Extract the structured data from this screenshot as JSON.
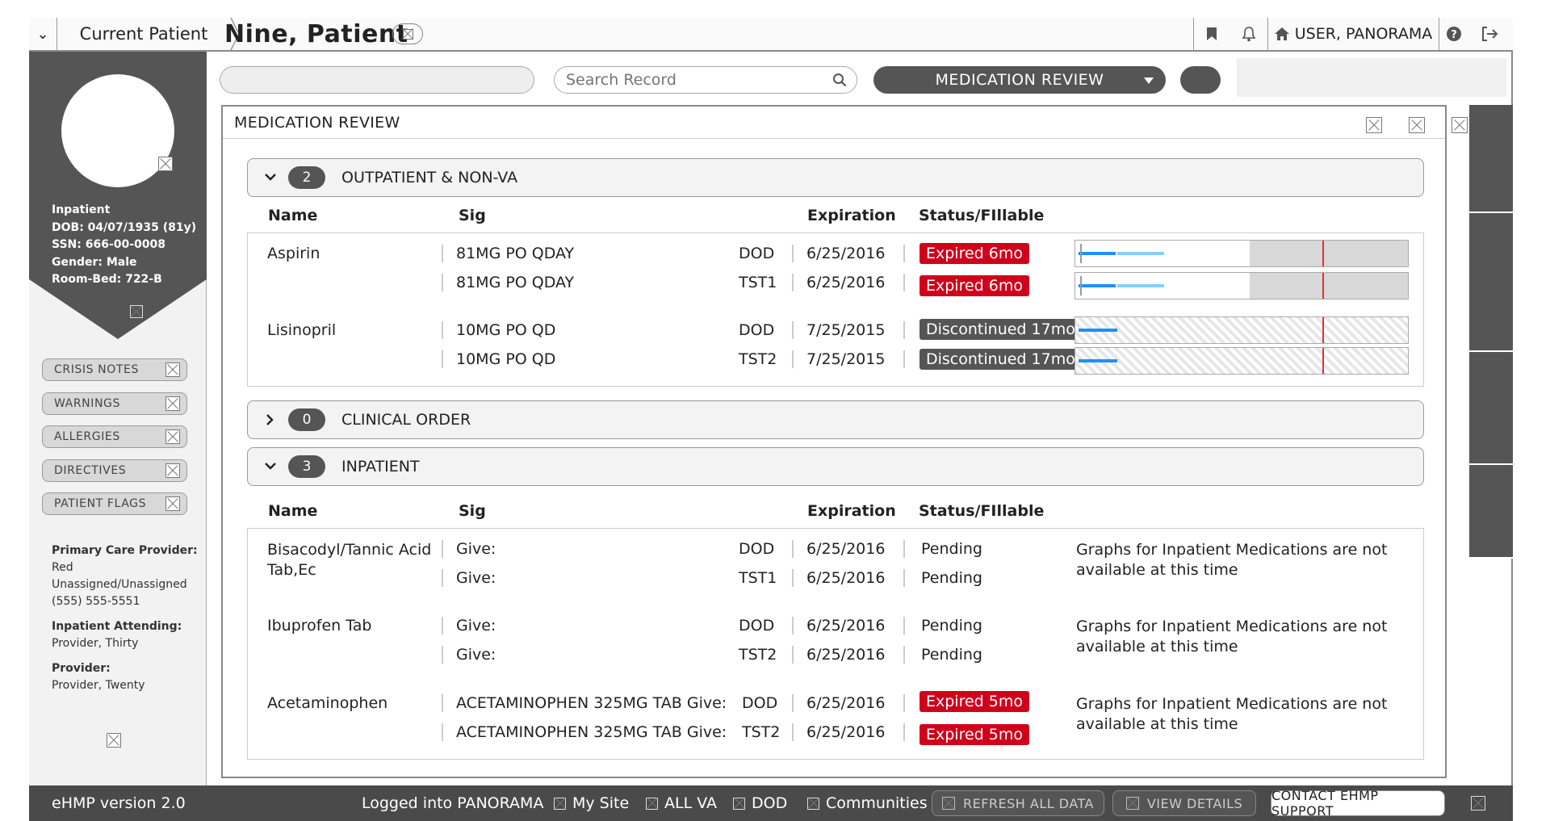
{
  "topbar": {
    "context_label": "Current Patient",
    "patient_name": "Nine, Patient",
    "user_label": "USER, PANORAMA"
  },
  "toolbar": {
    "search_placeholder": "Search Record",
    "workspace_label": "MEDICATION REVIEW"
  },
  "patient": {
    "status": "Inpatient",
    "dob": "DOB: 04/07/1935 (81y)",
    "ssn": "SSN: 666-00-0008",
    "gender": "Gender: Male",
    "room": "Room-Bed: 722-B"
  },
  "sidebar": {
    "buttons": [
      "CRISIS NOTES",
      "WARNINGS",
      "ALLERGIES",
      "DIRECTIVES",
      "PATIENT FLAGS"
    ],
    "pcp_label": "Primary Care Provider:",
    "pcp_lines": [
      "Red",
      "Unassigned/Unassigned",
      "(555) 555-5551"
    ],
    "attending_label": "Inpatient Attending:",
    "attending_value": "Provider, Thirty",
    "provider_label": "Provider:",
    "provider_value": "Provider, Twenty"
  },
  "panel": {
    "title": "MEDICATION REVIEW",
    "columns": {
      "name": "Name",
      "sig": "Sig",
      "expiration": "Expiration",
      "status": "Status/FIllable"
    },
    "groups": [
      {
        "label": "OUTPATIENT & NON-VA",
        "count": "2"
      },
      {
        "label": "CLINICAL ORDER",
        "count": "0"
      },
      {
        "label": "INPATIENT",
        "count": "3"
      }
    ],
    "outpatient": [
      {
        "name": "Aspirin",
        "lines": [
          {
            "sig": "81MG PO QDAY",
            "site": "DOD",
            "exp": "6/25/2016",
            "status": "Expired 6mo"
          },
          {
            "sig": "81MG PO QDAY",
            "site": "TST1",
            "exp": "6/25/2016",
            "status": "Expired 6mo"
          }
        ]
      },
      {
        "name": "Lisinopril",
        "lines": [
          {
            "sig": "10MG PO QD",
            "site": "DOD",
            "exp": "7/25/2015",
            "status": "Discontinued 17mo"
          },
          {
            "sig": "10MG PO QD",
            "site": "TST2",
            "exp": "7/25/2015",
            "status": "Discontinued 17mo"
          }
        ]
      }
    ],
    "inpatient": [
      {
        "name": "Bisacodyl/Tannic Acid Tab,Ec",
        "name_line1": "Bisacodyl/Tannic Acid",
        "name_line2": "Tab,Ec",
        "lines": [
          {
            "sig": "Give:",
            "site": "DOD",
            "exp": "6/25/2016",
            "status": "Pending"
          },
          {
            "sig": "Give:",
            "site": "TST1",
            "exp": "6/25/2016",
            "status": "Pending"
          }
        ]
      },
      {
        "name": "Ibuprofen Tab",
        "lines": [
          {
            "sig": "Give:",
            "site": "DOD",
            "exp": "6/25/2016",
            "status": "Pending"
          },
          {
            "sig": "Give:",
            "site": "TST2",
            "exp": "6/25/2016",
            "status": "Pending"
          }
        ]
      },
      {
        "name": "Acetaminophen",
        "lines": [
          {
            "sig": "ACETAMINOPHEN 325MG TAB Give:",
            "site": "DOD",
            "exp": "6/25/2016",
            "status": "Expired 5mo"
          },
          {
            "sig": "ACETAMINOPHEN 325MG TAB Give:",
            "site": "TST2",
            "exp": "6/25/2016",
            "status": "Expired 5mo"
          }
        ]
      }
    ],
    "inpatient_graph_note_line1": "Graphs for Inpatient Medications are not",
    "inpatient_graph_note_line2": "available at this time"
  },
  "footer": {
    "version": "eHMP version 2.0",
    "logged_in": "Logged into PANORAMA",
    "filters": [
      "My Site",
      "ALL VA",
      "DOD",
      "Communities"
    ],
    "refresh": "REFRESH ALL DATA",
    "view_details": "VIEW DETAILS",
    "support": "CONTACT EHMP SUPPORT"
  },
  "colors": {
    "expired": "#d0021b",
    "discontinued": "#555555",
    "graph_bar": "#1e90ff",
    "graph_now": "#e03030"
  }
}
